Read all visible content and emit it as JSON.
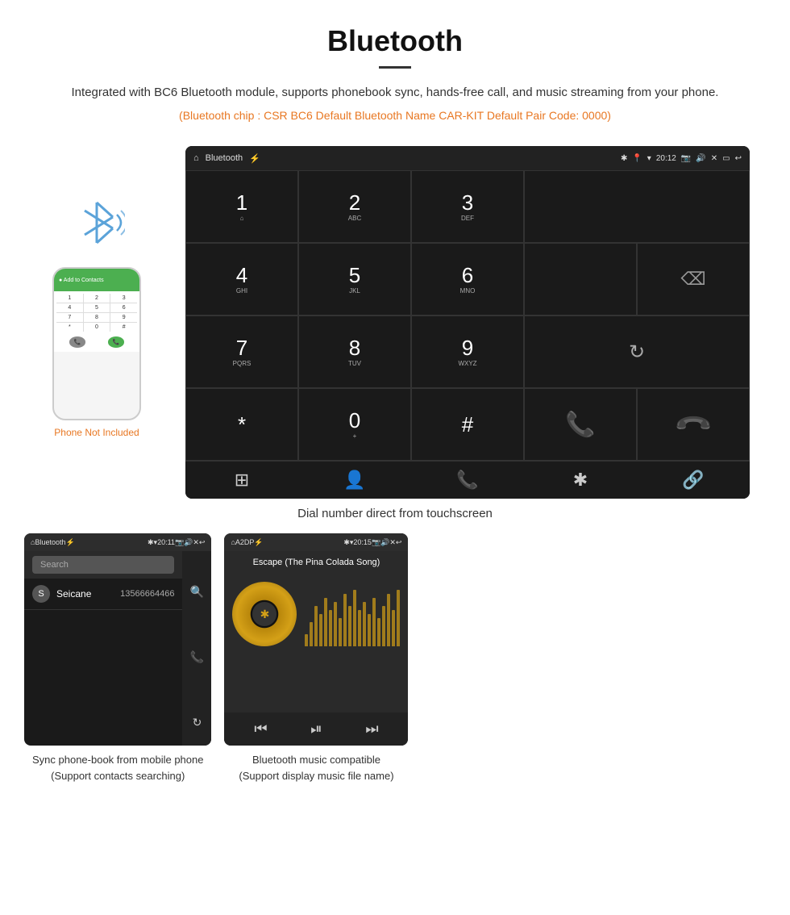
{
  "header": {
    "title": "Bluetooth",
    "description": "Integrated with BC6 Bluetooth module, supports phonebook sync, hands-free call, and music streaming from your phone.",
    "specs": "(Bluetooth chip : CSR BC6    Default Bluetooth Name CAR-KIT    Default Pair Code: 0000)"
  },
  "phone_label": "Phone Not Included",
  "dialpad_screen": {
    "title": "Bluetooth",
    "time": "20:12",
    "keys": [
      {
        "num": "1",
        "sub": "⌂"
      },
      {
        "num": "2",
        "sub": "ABC"
      },
      {
        "num": "3",
        "sub": "DEF"
      },
      {
        "num": "4",
        "sub": "GHI"
      },
      {
        "num": "5",
        "sub": "JKL"
      },
      {
        "num": "6",
        "sub": "MNO"
      },
      {
        "num": "7",
        "sub": "PQRS"
      },
      {
        "num": "8",
        "sub": "TUV"
      },
      {
        "num": "9",
        "sub": "WXYZ"
      },
      {
        "num": "*",
        "sub": ""
      },
      {
        "num": "0",
        "sub": "+"
      },
      {
        "num": "#",
        "sub": ""
      }
    ],
    "bottom_nav": [
      "⊞",
      "👤",
      "📞",
      "✱",
      "🔗"
    ]
  },
  "caption_dialpad": "Dial number direct from touchscreen",
  "phonebook_screen": {
    "title": "Bluetooth",
    "time": "20:11",
    "search_placeholder": "Search",
    "contact_letter": "S",
    "contact_name": "Seicane",
    "contact_number": "13566664466"
  },
  "caption_phonebook_line1": "Sync phone-book from mobile phone",
  "caption_phonebook_line2": "(Support contacts searching)",
  "music_screen": {
    "title": "A2DP",
    "time": "20:15",
    "song_title": "Escape (The Pina Colada Song)"
  },
  "caption_music_line1": "Bluetooth music compatible",
  "caption_music_line2": "(Support display music file name)",
  "eq_bars": [
    15,
    30,
    50,
    40,
    60,
    45,
    55,
    35,
    65,
    50,
    70,
    45,
    55,
    40,
    60,
    35,
    50,
    65,
    45,
    70
  ]
}
